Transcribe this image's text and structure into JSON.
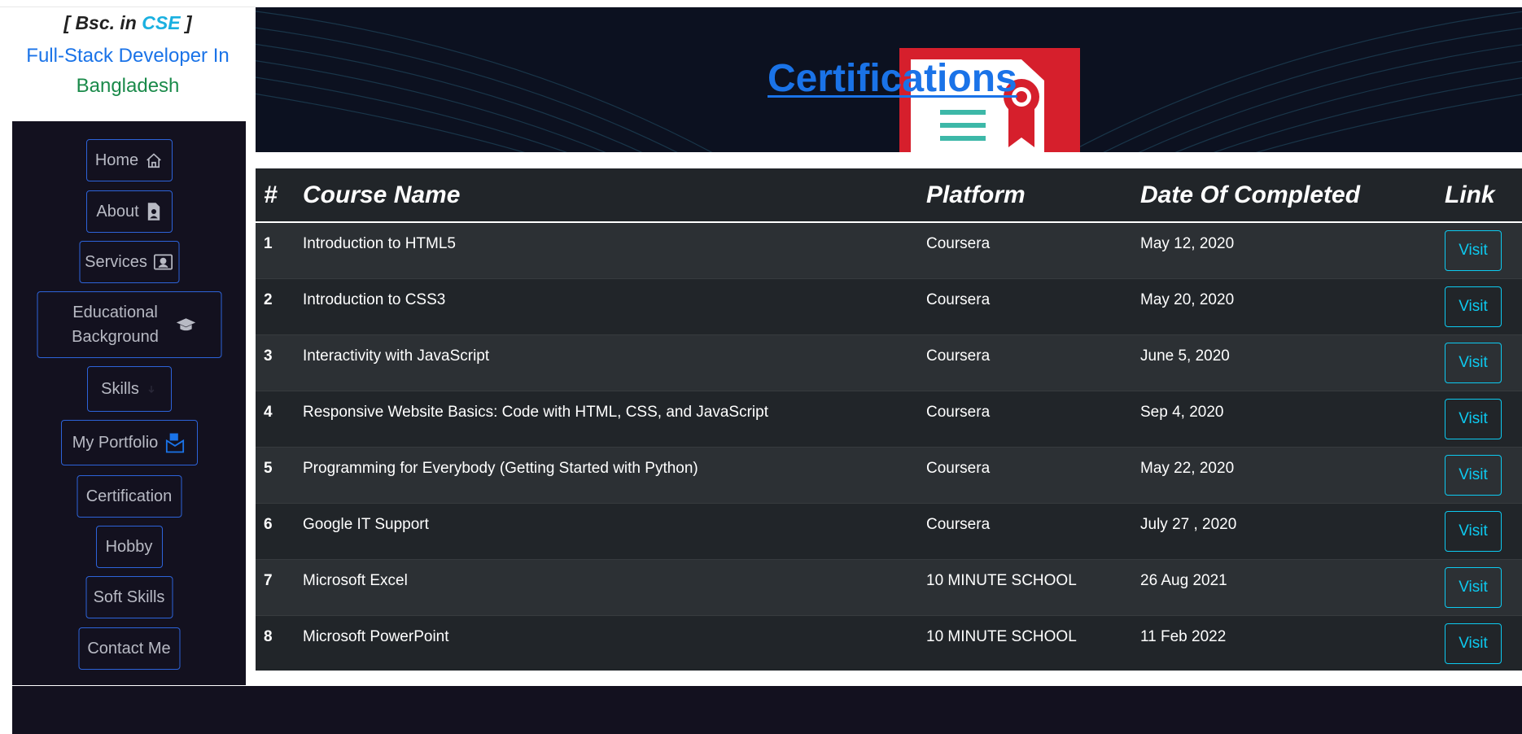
{
  "profile": {
    "degree_prefix": "[ Bsc. in ",
    "degree_accent": "CSE",
    "degree_suffix": " ]",
    "role_line1": "Full-Stack Developer In",
    "role_line2": "Bangladesh"
  },
  "nav": [
    {
      "label": "Home",
      "icon": "house-icon"
    },
    {
      "label": "About",
      "icon": "person-badge-icon"
    },
    {
      "label": "Services",
      "icon": "person-video-icon"
    },
    {
      "label": "Educational Background",
      "icon": "graduation-cap-icon"
    },
    {
      "label": "Skills",
      "icon": "skills-icon"
    },
    {
      "label": "My Portfolio",
      "icon": "envelope-paper-icon"
    },
    {
      "label": "Certification",
      "icon": ""
    },
    {
      "label": "Hobby",
      "icon": ""
    },
    {
      "label": "Soft Skills",
      "icon": ""
    },
    {
      "label": "Contact Me",
      "icon": ""
    }
  ],
  "banner": {
    "title": "Certifications",
    "image": "certificate-icon"
  },
  "table": {
    "headers": [
      "#",
      "Course Name",
      "Platform",
      "Date Of Completed",
      "Link"
    ],
    "rows": [
      {
        "num": "1",
        "course": "Introduction to HTML5",
        "platform": "Coursera",
        "date": "May 12, 2020",
        "link": "Visit"
      },
      {
        "num": "2",
        "course": "Introduction to CSS3",
        "platform": "Coursera",
        "date": "May 20, 2020",
        "link": "Visit"
      },
      {
        "num": "3",
        "course": "Interactivity with JavaScript",
        "platform": "Coursera",
        "date": "June 5, 2020",
        "link": "Visit"
      },
      {
        "num": "4",
        "course": "Responsive Website Basics: Code with HTML, CSS, and JavaScript",
        "platform": "Coursera",
        "date": "Sep 4, 2020",
        "link": "Visit"
      },
      {
        "num": "5",
        "course": "Programming for Everybody (Getting Started with Python)",
        "platform": "Coursera",
        "date": "May 22, 2020",
        "link": "Visit"
      },
      {
        "num": "6",
        "course": "Google IT Support",
        "platform": "Coursera",
        "date": "July 27 , 2020",
        "link": "Visit"
      },
      {
        "num": "7",
        "course": "Microsoft Excel",
        "platform": "10 MINUTE SCHOOL",
        "date": "26 Aug 2021",
        "link": "Visit"
      },
      {
        "num": "8",
        "course": "Microsoft PowerPoint",
        "platform": "10 MINUTE SCHOOL",
        "date": "11 Feb 2022",
        "link": "Visit"
      }
    ]
  },
  "colors": {
    "sidebar_bg": "#13111f",
    "nav_border": "#2d63d9",
    "title_blue": "#1a73e8",
    "visit_cyan": "#0dcaf0",
    "table_bg": "#212529"
  }
}
